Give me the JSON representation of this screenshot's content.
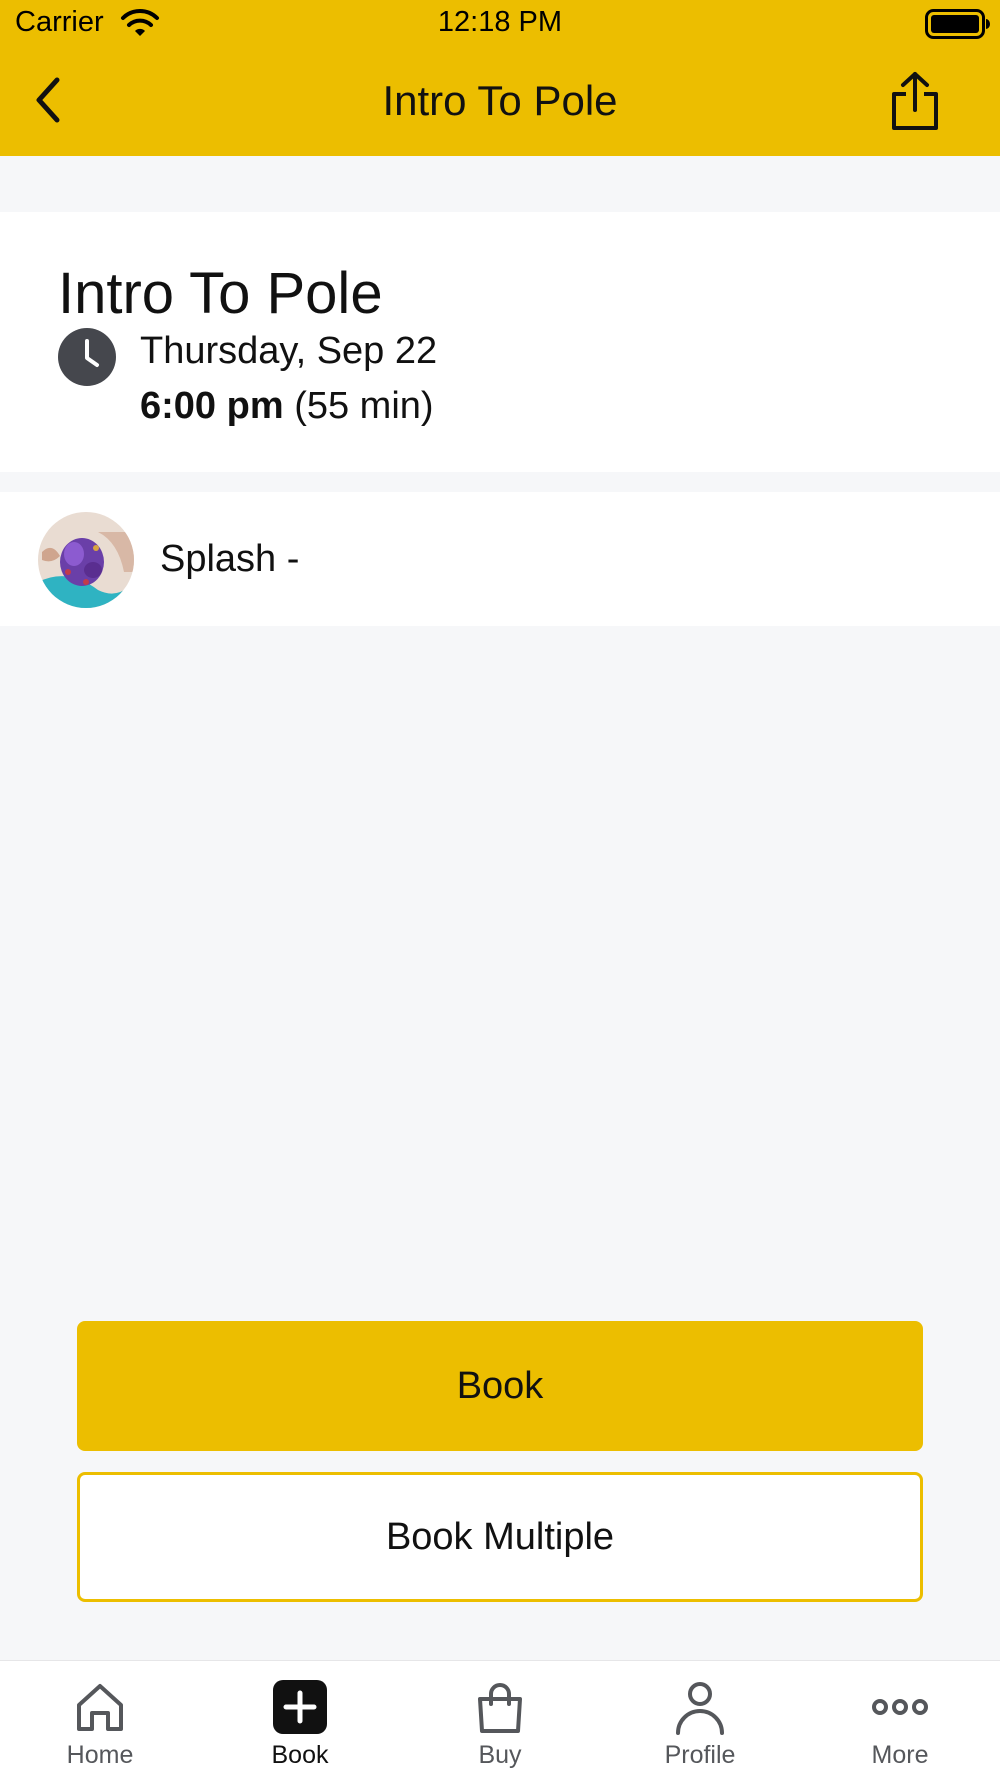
{
  "status_bar": {
    "carrier": "Carrier",
    "time": "12:18 PM"
  },
  "nav": {
    "title": "Intro To Pole",
    "back_icon": "chevron-left-icon",
    "share_icon": "share-icon"
  },
  "class": {
    "title": "Intro To Pole",
    "date": "Thursday, Sep 22",
    "time": "6:00 pm",
    "duration": "(55 min)"
  },
  "instructor": {
    "name": "Splash -"
  },
  "actions": {
    "book_label": "Book",
    "book_multiple_label": "Book Multiple"
  },
  "tabbar": {
    "items": [
      {
        "label": "Home",
        "icon": "home-icon"
      },
      {
        "label": "Book",
        "icon": "plus-square-icon",
        "active": true
      },
      {
        "label": "Buy",
        "icon": "shopping-bag-icon"
      },
      {
        "label": "Profile",
        "icon": "person-icon"
      },
      {
        "label": "More",
        "icon": "more-dots-icon"
      }
    ]
  },
  "colors": {
    "accent": "#ECBE00",
    "background": "#F6F7F9",
    "card": "#FFFFFF",
    "text": "#111111",
    "tab_inactive": "#55575B"
  }
}
